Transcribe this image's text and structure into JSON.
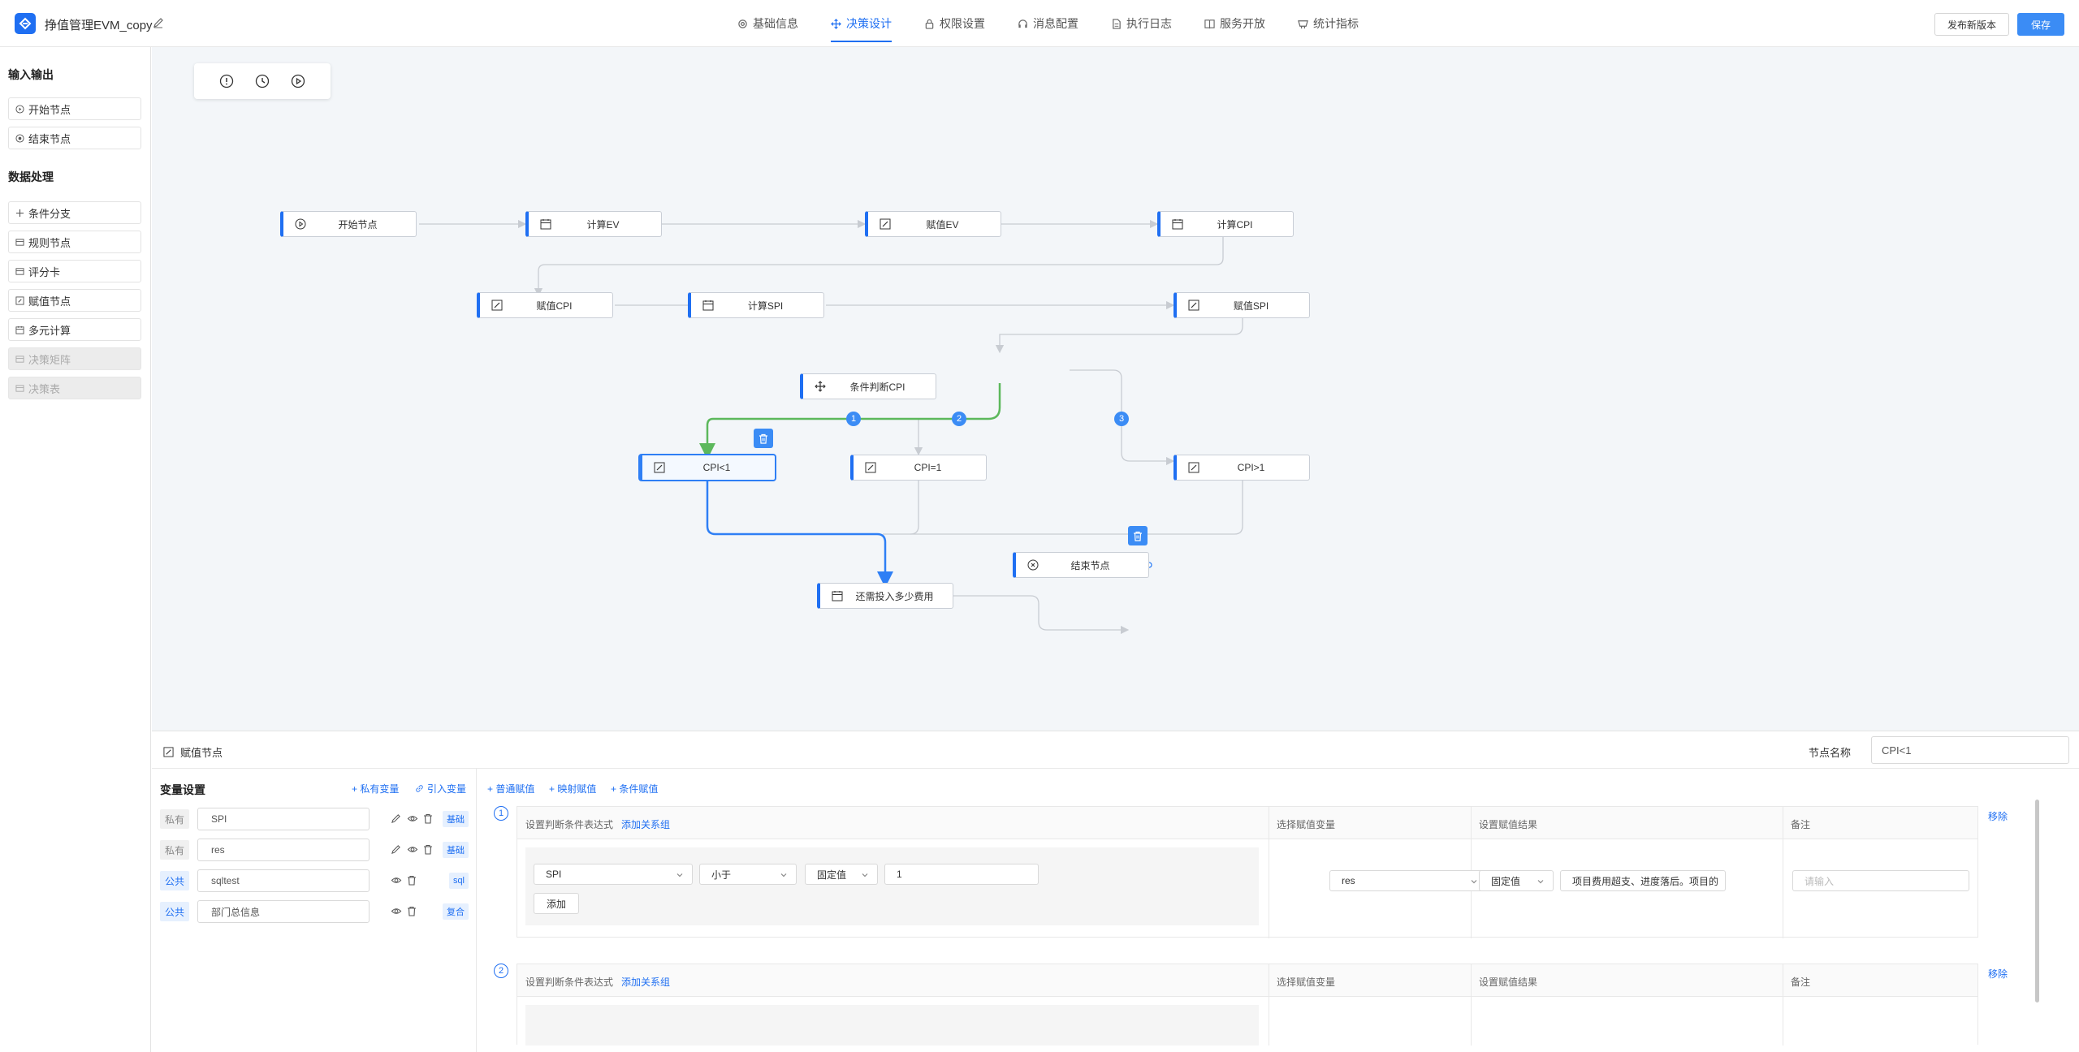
{
  "header": {
    "title": "挣值管理EVM_copy",
    "tabs": [
      {
        "label": "基础信息",
        "icon": "gear-icon"
      },
      {
        "label": "决策设计",
        "icon": "move-icon",
        "active": true
      },
      {
        "label": "权限设置",
        "icon": "lock-icon"
      },
      {
        "label": "消息配置",
        "icon": "headset-icon"
      },
      {
        "label": "执行日志",
        "icon": "file-icon"
      },
      {
        "label": "服务开放",
        "icon": "book-icon"
      },
      {
        "label": "统计指标",
        "icon": "chart-icon"
      }
    ],
    "publish_label": "发布新版本",
    "save_label": "保存"
  },
  "sidebar": {
    "section_io": "输入输出",
    "io_items": [
      {
        "label": "开始节点",
        "icon": "play-icon"
      },
      {
        "label": "结束节点",
        "icon": "stop-icon"
      }
    ],
    "section_data": "数据处理",
    "data_items": [
      {
        "label": "条件分支",
        "icon": "branch-icon"
      },
      {
        "label": "规则节点",
        "icon": "rule-icon"
      },
      {
        "label": "评分卡",
        "icon": "card-icon"
      },
      {
        "label": "赋值节点",
        "icon": "edit-icon"
      },
      {
        "label": "多元计算",
        "icon": "calendar-icon"
      },
      {
        "label": "决策矩阵",
        "icon": "matrix-icon",
        "disabled": true
      },
      {
        "label": "决策表",
        "icon": "table-icon",
        "disabled": true
      }
    ]
  },
  "canvas": {
    "nodes": [
      {
        "label": "开始节点",
        "icon": "play-icon"
      },
      {
        "label": "计算EV",
        "icon": "calendar-icon"
      },
      {
        "label": "赋值EV",
        "icon": "edit-icon"
      },
      {
        "label": "计算CPI",
        "icon": "calendar-icon"
      },
      {
        "label": "赋值CPI",
        "icon": "edit-icon"
      },
      {
        "label": "计算SPI",
        "icon": "calendar-icon"
      },
      {
        "label": "赋值SPI",
        "icon": "edit-icon"
      },
      {
        "label": "条件判断CPI",
        "icon": "branch-icon"
      },
      {
        "label": "CPI<1",
        "icon": "edit-icon"
      },
      {
        "label": "CPI=1",
        "icon": "edit-icon"
      },
      {
        "label": "CPI>1",
        "icon": "edit-icon"
      },
      {
        "label": "结束节点",
        "icon": "stop-icon"
      },
      {
        "label": "还需投入多少费用",
        "icon": "calendar-icon"
      }
    ],
    "branch_badges": [
      "1",
      "2",
      "3"
    ]
  },
  "bottom": {
    "node_type": "赋值节点",
    "node_name_label": "节点名称",
    "node_name_value": "CPI<1",
    "var_title": "变量设置",
    "add_private": "+ 私有变量",
    "import_var": "引入变量",
    "variables": [
      {
        "scope": "私有",
        "name": "SPI",
        "tag": "基础"
      },
      {
        "scope": "私有",
        "name": "res",
        "tag": "基础"
      },
      {
        "scope": "公共",
        "name": "sqltest",
        "tag": "sql"
      },
      {
        "scope": "公共",
        "name": "部门总信息",
        "tag": "复合"
      }
    ],
    "rule_tabs": [
      "+ 普通赋值",
      "+ 映射赋值",
      "+ 条件赋值"
    ],
    "headers": {
      "cond": "设置判断条件表达式",
      "add_group": "添加关系组",
      "var": "选择赋值变量",
      "result": "设置赋值结果",
      "note": "备注"
    },
    "rules": [
      {
        "num": "1",
        "cond_var": "SPI",
        "operator": "小于",
        "value_type": "固定值",
        "value": "1",
        "add_label": "添加",
        "assign_var": "res",
        "result_type": "固定值",
        "result_value": "项目费用超支、进度落后。项目的",
        "note_placeholder": "请输入",
        "remove": "移除"
      },
      {
        "num": "2",
        "remove": "移除"
      }
    ]
  },
  "colors": {
    "accent": "#1f6ff2",
    "edge_active": "#5cb85c",
    "edge_selected": "#2e7ff5",
    "edge_default": "#c8ccd2"
  }
}
